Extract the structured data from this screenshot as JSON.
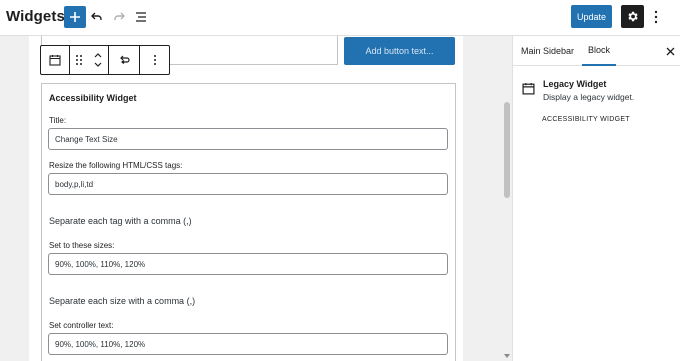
{
  "header": {
    "title": "Widgets",
    "update_label": "Update"
  },
  "canvas": {
    "add_button_text": "Add button text..."
  },
  "widget": {
    "name": "Accessibility Widget",
    "title_label": "Title:",
    "title_value": "Change Text Size",
    "tags_label": "Resize the following HTML/CSS tags:",
    "tags_value": "body,p,li,td",
    "tags_note": "Separate each tag with a comma (,)",
    "sizes_label": "Set to these sizes:",
    "sizes_value": "90%, 100%, 110%, 120%",
    "sizes_note": "Separate each size with a comma (,)",
    "controller_label": "Set controller text:",
    "controller_value": "90%, 100%, 110%, 120%"
  },
  "sidebar": {
    "tabs": [
      {
        "label": "Main Sidebar"
      },
      {
        "label": "Block"
      }
    ],
    "block_card": {
      "title": "Legacy Widget",
      "description": "Display a legacy widget.",
      "widget_tag": "ACCESSIBILITY WIDGET"
    }
  },
  "colors": {
    "accent": "#2271b1",
    "dark": "#1e1e1e"
  },
  "icons": [
    "plus-icon",
    "undo-icon",
    "redo-icon",
    "list-view-icon",
    "gear-icon",
    "more-vertical-icon",
    "calendar-icon",
    "drag-handle-icon",
    "move-up-down-icon",
    "transform-icon",
    "close-icon"
  ]
}
